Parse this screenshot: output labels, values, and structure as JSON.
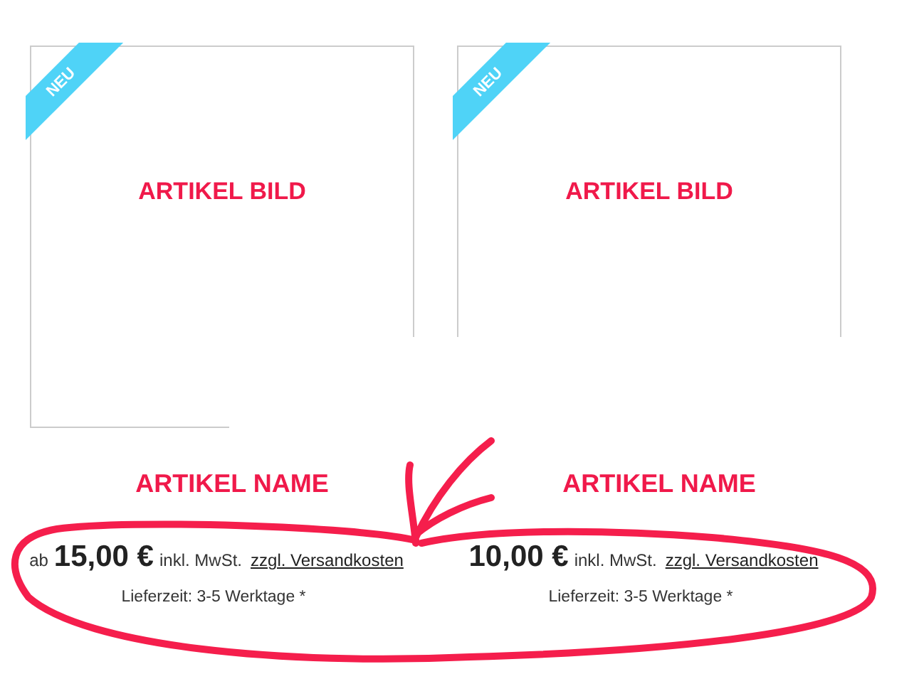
{
  "products": [
    {
      "badge": "NEU",
      "image_label": "ARTIKEL BILD",
      "name": "ARTIKEL NAME",
      "price_prefix": "ab",
      "price": "15,00 €",
      "tax": "inkl. MwSt.",
      "shipping": "zzgl. Versandkosten",
      "delivery": "Lieferzeit: 3-5 Werktage *"
    },
    {
      "badge": "NEU",
      "image_label": "ARTIKEL BILD",
      "name": "ARTIKEL NAME",
      "price": "10,00 €",
      "tax": "inkl. MwSt.",
      "shipping": "zzgl. Versandkosten",
      "delivery": "Lieferzeit: 3-5 Werktage *"
    }
  ]
}
